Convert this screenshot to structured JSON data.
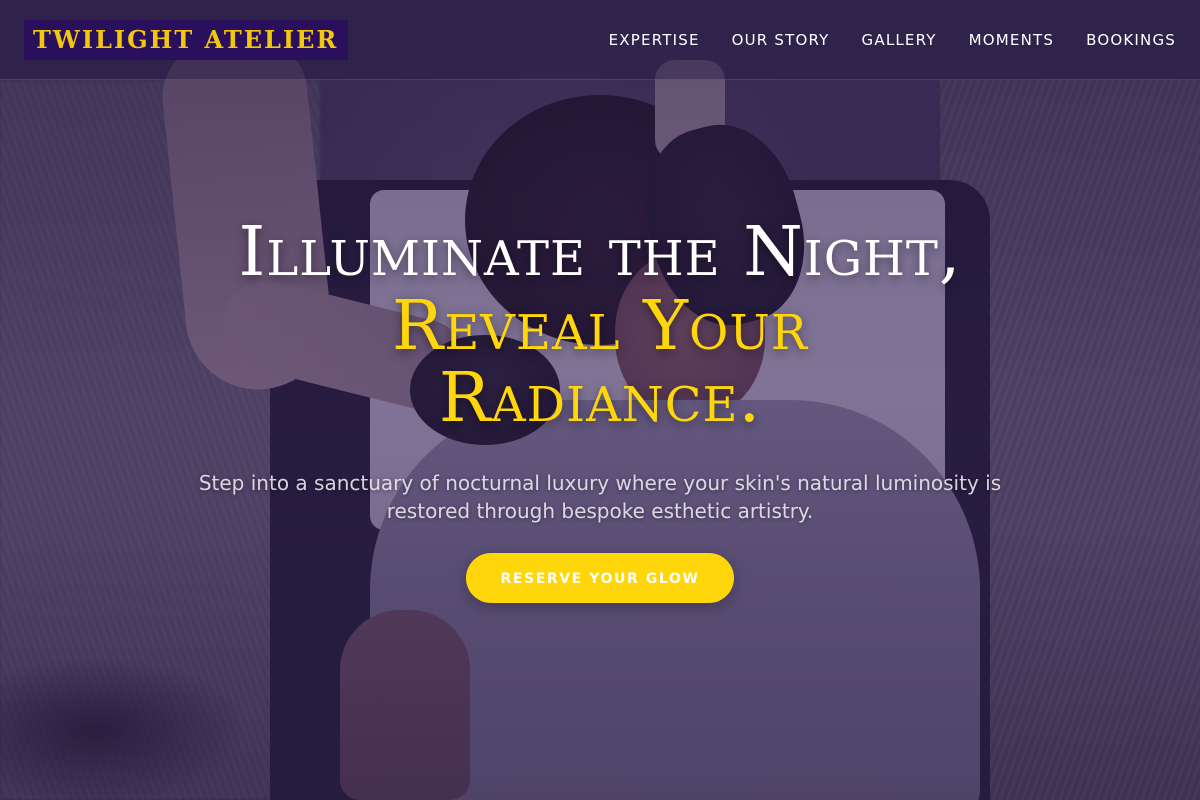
{
  "header": {
    "logo_text": "TWILIGHT ATELIER",
    "nav": [
      {
        "label": "EXPERTISE"
      },
      {
        "label": "OUR STORY"
      },
      {
        "label": "GALLERY"
      },
      {
        "label": "MOMENTS"
      },
      {
        "label": "BOOKINGS"
      }
    ]
  },
  "hero": {
    "headline_line1": "Illuminate the Night,",
    "headline_line2": "Reveal Your Radiance.",
    "subtitle": "Step into a sanctuary of nocturnal luxury where your skin's natural luminosity is restored through bespoke esthetic artistry.",
    "cta_label": "RESERVE YOUR GLOW"
  },
  "colors": {
    "accent_gold": "#ffd60a",
    "logo_background": "#2a0f5c",
    "overlay_purple": "#301c52"
  }
}
